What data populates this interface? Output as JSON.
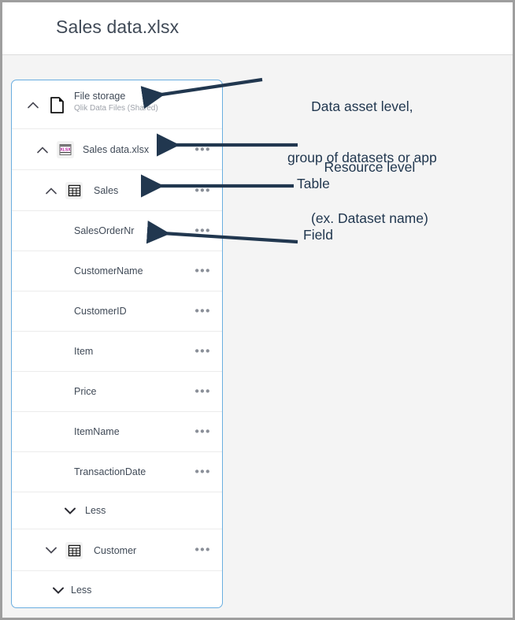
{
  "header": {
    "title": "Sales data.xlsx"
  },
  "tree": {
    "file_storage": {
      "label": "File storage",
      "sublabel": "Qlik Data Files (Shared)",
      "icon": "document-icon",
      "chevron": "chevron-up-icon"
    },
    "dataset": {
      "label": "Sales data.xlsx",
      "icon": "xlsx-file-icon",
      "icon_text": "XLSX",
      "chevron": "chevron-up-icon",
      "menu": "•••"
    },
    "table_sales": {
      "label": "Sales",
      "icon": "table-icon",
      "chevron": "chevron-up-icon",
      "menu": "•••"
    },
    "fields": [
      {
        "label": "SalesOrderNr",
        "menu": "•••"
      },
      {
        "label": "CustomerName",
        "menu": "•••"
      },
      {
        "label": "CustomerID",
        "menu": "•••"
      },
      {
        "label": "Item",
        "menu": "•••"
      },
      {
        "label": "Price",
        "menu": "•••"
      },
      {
        "label": "ItemName",
        "menu": "•••"
      },
      {
        "label": "TransactionDate",
        "menu": "•••"
      }
    ],
    "less_fields": {
      "label": "Less",
      "chevron": "chevron-down-icon"
    },
    "table_customer": {
      "label": "Customer",
      "icon": "table-icon",
      "chevron": "chevron-down-icon",
      "menu": "•••"
    },
    "less_tables": {
      "label": "Less",
      "chevron": "chevron-down-icon"
    }
  },
  "annotations": [
    {
      "id": "data-asset",
      "line1": "Data asset level,",
      "line2": "group of datasets or app"
    },
    {
      "id": "resource",
      "line1": "Resource level",
      "line2": "(ex. Dataset name)"
    },
    {
      "id": "table",
      "line1": "Table",
      "line2": ""
    },
    {
      "id": "field",
      "line1": "Field",
      "line2": ""
    }
  ],
  "colors": {
    "annotation": "#21374f",
    "panel_border": "#6aaee0",
    "text": "#404a57",
    "sub_text": "#9fa3ab",
    "xlsx_accent": "#b5199c",
    "frame": "#9e9e9e",
    "background": "#f4f4f4"
  }
}
